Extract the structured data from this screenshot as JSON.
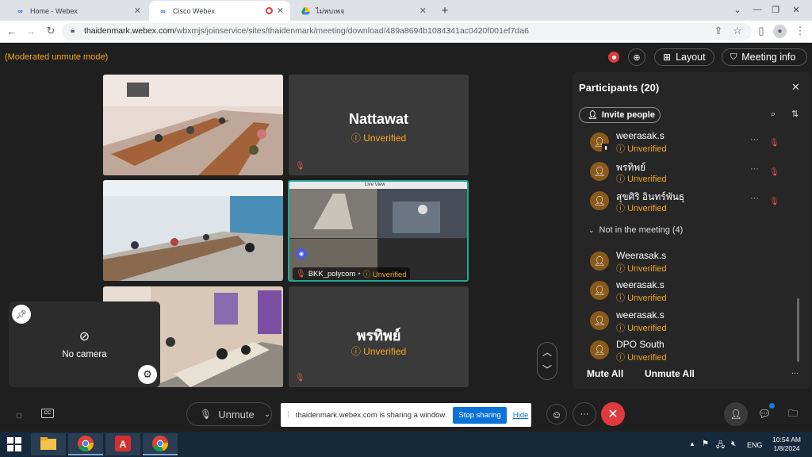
{
  "browser": {
    "tabs": [
      {
        "title": "Home - Webex",
        "icon": "webex-icon"
      },
      {
        "title": "Cisco Webex",
        "icon": "webex-icon",
        "recording": true
      },
      {
        "title": "ไม่พบเพจ",
        "icon": "google-drive-icon"
      }
    ],
    "url_host": "thaidenmark.webex.com",
    "url_path": "/wbxmjs/joinservice/sites/thaidenmark/meeting/download/489a8694b1084341ac0420f001ef7da6"
  },
  "meeting": {
    "mode_text": "(Moderated unmute mode)",
    "layout_label": "Layout",
    "meeting_info_label": "Meeting info",
    "tiles": [
      {
        "name": "",
        "status": ""
      },
      {
        "name": "Nattawat",
        "status": "Unverified"
      },
      {
        "name": "",
        "status": ""
      },
      {
        "name": "BKK_polycom",
        "status": "Unverified",
        "separator": "•",
        "screen_title": "Live View"
      },
      {
        "name": "",
        "status": ""
      },
      {
        "name": "พรทิพย์",
        "status": "Unverified"
      }
    ],
    "self_view": {
      "label": "No camera"
    }
  },
  "participants": {
    "title": "Participants (20)",
    "invite_label": "Invite people",
    "in_meeting": [
      {
        "name": "weerasak.s",
        "status": "Unverified"
      },
      {
        "name": "พรทิพย์",
        "status": "Unverified"
      },
      {
        "name": "สุขศิริ อินทร์พันธุ",
        "status": "Unverified"
      }
    ],
    "not_in_meeting_label": "Not in the meeting (4)",
    "not_in_meeting": [
      {
        "name": "Weerasak.s",
        "status": "Unverified"
      },
      {
        "name": "weerasak.s",
        "status": "Unverified"
      },
      {
        "name": "weerasak.s",
        "status": "Unverified"
      },
      {
        "name": "DPO South",
        "status": "Unverified"
      }
    ],
    "mute_all_label": "Mute All",
    "unmute_all_label": "Unmute All",
    "more_label": "..."
  },
  "controls": {
    "unmute_label": "Unmute",
    "sharing_text": "thaidenmark.webex.com is sharing a window.",
    "stop_sharing_label": "Stop sharing",
    "hide_label": "Hide",
    "more_label": "···"
  },
  "taskbar": {
    "time": "10:54 AM",
    "date": "1/8/2024",
    "lang": "ENG"
  },
  "colors": {
    "accent_orange": "#f5a623",
    "end_call_red": "#e0393e",
    "stop_sharing_blue": "#0b72d9",
    "active_speaker_border": "#1fa89a"
  }
}
